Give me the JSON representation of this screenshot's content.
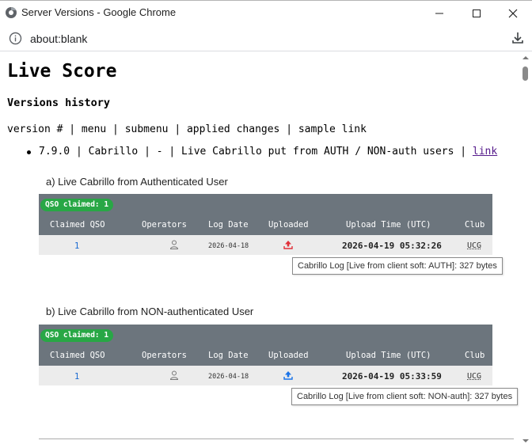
{
  "window": {
    "title": "Server Versions - Google Chrome",
    "url": "about:blank"
  },
  "page": {
    "h1": "Live Score",
    "h3": "Versions history",
    "header_line": "version # | menu | submenu | applied changes | sample link",
    "bullet": {
      "version": "7.9.0",
      "menu": "Cabrillo",
      "submenu": "-",
      "changes": "Live Cabrillo put from AUTH / NON-auth users",
      "link_text": "link"
    }
  },
  "columns": [
    "Claimed QSO",
    "Operators",
    "Log Date",
    "Uploaded",
    "Upload Time (UTC)",
    "Club"
  ],
  "sections": [
    {
      "label": "a) Live Cabrillo from Authenticated User",
      "badge": "QSO claimed: 1",
      "row": {
        "claimed": "1",
        "log_date": "2026-04-18",
        "upload_time": "2026-04-19 05:32:26",
        "club": "UCG",
        "upload_icon": "upload-icon-red",
        "upload_color": "#e0303a"
      },
      "tooltip": "Cabrillo Log [Live from client soft: AUTH]: 327 bytes"
    },
    {
      "label": "b) Live Cabrillo from NON-authenticated User",
      "badge": "QSO claimed: 1",
      "row": {
        "claimed": "1",
        "log_date": "2026-04-18",
        "upload_time": "2026-04-19 05:33:59",
        "club": "UCG",
        "upload_icon": "upload-icon-blue",
        "upload_color": "#1a73e8"
      },
      "tooltip": "Cabrillo Log [Live from client soft: NON-auth]: 327 bytes"
    }
  ],
  "colors": {
    "table_header": "#6c757d",
    "badge": "#28a745",
    "link": "#551a8b"
  }
}
